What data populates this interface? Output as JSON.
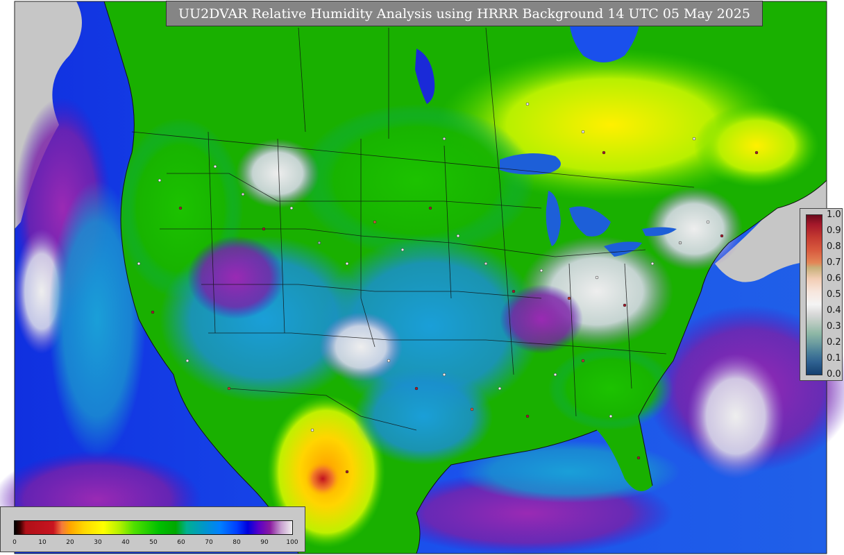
{
  "title": "UU2DVAR Relative Humidity Analysis using HRRR Background 14 UTC 05 May 2025",
  "station_colorbar": {
    "labels": [
      "1.0",
      "0.9",
      "0.8",
      "0.7",
      "0.6",
      "0.5",
      "0.4",
      "0.3",
      "0.2",
      "0.1",
      "0.0"
    ]
  },
  "rh_colorbar": {
    "labels": [
      "0",
      "10",
      "20",
      "30",
      "40",
      "50",
      "60",
      "70",
      "80",
      "90",
      "100"
    ]
  },
  "colors": {
    "ocean_blue": "#1a46e8",
    "land_green": "#19b800",
    "moist_yellow": "#e6f000",
    "dry_blue": "#1e96d2",
    "saturated_white": "#e6e6e6",
    "purple": "#7a1fa8"
  }
}
